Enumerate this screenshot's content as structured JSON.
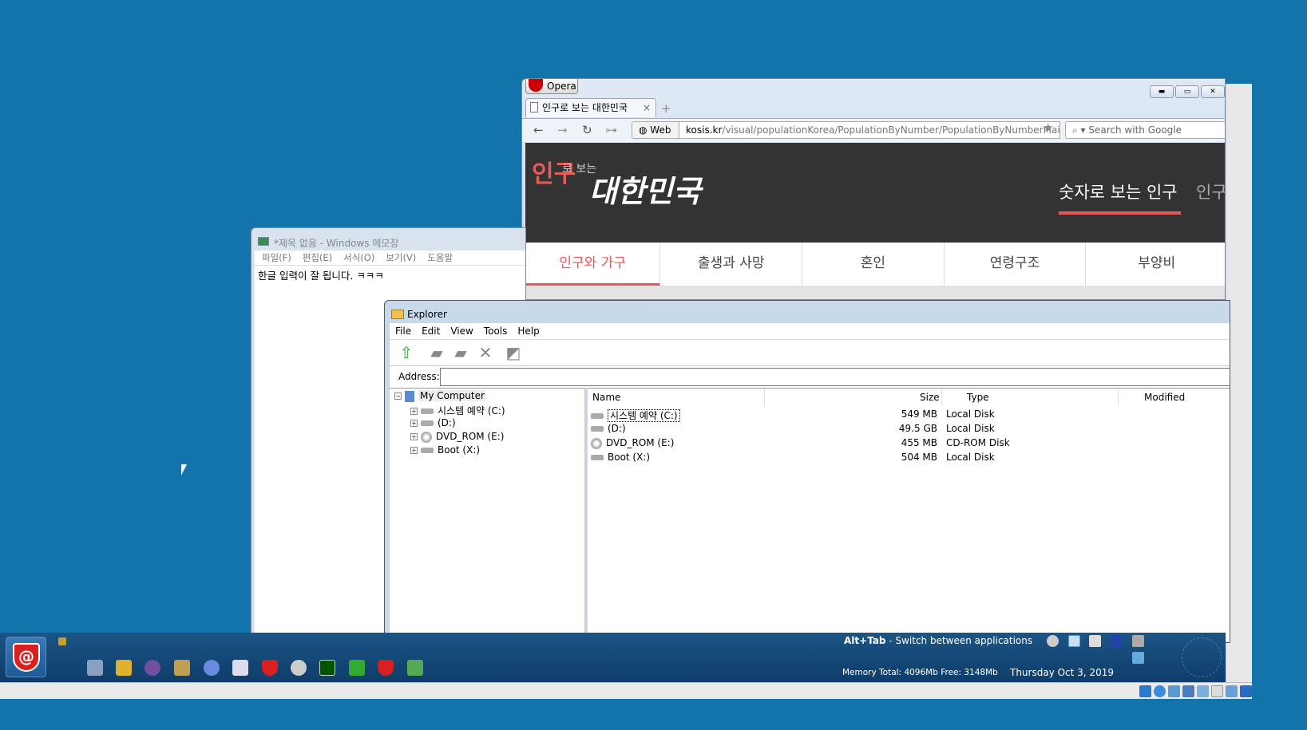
{
  "opera": {
    "menu_button": "Opera",
    "tab_title": "인구로 보는 대한민국",
    "tab_close": "×",
    "new_tab": "+",
    "web_label": "Web",
    "url_domain": "kosis.kr",
    "url_path": "/visual/populationKorea/PopulationByNumber/PopulationByNumberMain.do",
    "search_placeholder": "Search with Google",
    "site": {
      "logo_red": "인구",
      "logo_small": "로 보는",
      "logo_main": "대한민국",
      "header_menu": [
        "숫자로 보는 인구",
        "인구"
      ],
      "nav": [
        "인구와 가구",
        "출생과 사망",
        "혼인",
        "연령구조",
        "부양비"
      ],
      "accent_color": "#e85a5a"
    }
  },
  "notepad": {
    "title": "*제목 없음 - Windows 메모장",
    "menu": [
      "파일(F)",
      "편집(E)",
      "서식(O)",
      "보기(V)",
      "도움말"
    ],
    "content": "한글 입력이 잘 됩니다. ㅋㅋㅋ"
  },
  "explorer": {
    "title": "Explorer",
    "menu": [
      "File",
      "Edit",
      "View",
      "Tools",
      "Help"
    ],
    "address_label": "Address:",
    "address_value": "",
    "tree": {
      "root": "My Computer",
      "children": [
        "시스템 예약 (C:)",
        "(D:)",
        "DVD_ROM (E:)",
        "Boot (X:)"
      ]
    },
    "columns": [
      "Name",
      "Size",
      "Type",
      "Modified"
    ],
    "rows": [
      {
        "name": "시스템 예약 (C:)",
        "size": "549 MB",
        "type": "Local Disk",
        "icon": "hard-drive"
      },
      {
        "name": "(D:)",
        "size": "49.5 GB",
        "type": "Local Disk",
        "icon": "hard-drive"
      },
      {
        "name": "DVD_ROM (E:)",
        "size": "455 MB",
        "type": "CD-ROM Disk",
        "icon": "cd-drive"
      },
      {
        "name": "Boot (X:)",
        "size": "504 MB",
        "type": "Local Disk",
        "icon": "hard-drive"
      }
    ]
  },
  "taskbar": {
    "alttab_key": "Alt+Tab",
    "alttab_text": " - Switch between applications",
    "memory": "Memory Total: 4096Mb Free: 3148Mb",
    "date": "Thursday  Oct 3, 2019"
  }
}
